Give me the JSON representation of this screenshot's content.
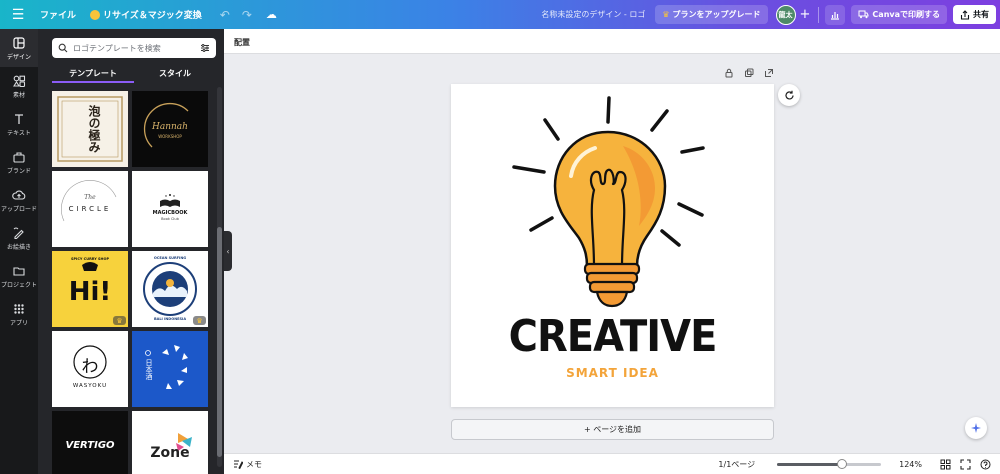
{
  "topbar": {
    "file_label": "ファイル",
    "magic_label": "リサイズ＆マジック変換",
    "doc_title": "名称未設定のデザイン - ロゴ",
    "upgrade_label": "プランをアップグレード",
    "avatar_initials": "龍太",
    "print_label": "Canvaで印刷する",
    "share_label": "共有"
  },
  "rail": [
    {
      "label": "デザイン",
      "icon": "design-icon"
    },
    {
      "label": "素材",
      "icon": "elements-icon"
    },
    {
      "label": "テキスト",
      "icon": "text-icon"
    },
    {
      "label": "ブランド",
      "icon": "brand-icon"
    },
    {
      "label": "アップロード",
      "icon": "upload-icon"
    },
    {
      "label": "お絵描き",
      "icon": "draw-icon"
    },
    {
      "label": "プロジェクト",
      "icon": "projects-icon"
    },
    {
      "label": "アプリ",
      "icon": "apps-icon"
    }
  ],
  "panel": {
    "search_placeholder": "ロゴテンプレートを検索",
    "tabs": [
      "テンプレート",
      "スタイル"
    ],
    "templates": [
      {
        "text": "泡の極み",
        "style": "awa"
      },
      {
        "text": "Hannah",
        "sub": "WORKSHOP",
        "style": "hannah"
      },
      {
        "text": "CIRCLE",
        "sub": "The",
        "style": "circle"
      },
      {
        "text": "MAGICBOOK",
        "sub": "Book Club",
        "style": "magicbook"
      },
      {
        "text": "Hi!",
        "sub": "SPICY CURRY SHOP",
        "style": "hi",
        "premium": true
      },
      {
        "text": "OCEAN SURFING",
        "sub": "BALI INDONESIA",
        "style": "ocean",
        "premium": true
      },
      {
        "text": "WASYOKU",
        "glyph": "わ",
        "style": "wasyoku"
      },
      {
        "text": "日本酒",
        "style": "sake"
      },
      {
        "text": "VERTIGO",
        "style": "vertigo"
      },
      {
        "text": "Zone",
        "style": "zone"
      }
    ]
  },
  "workspace": {
    "sub_label": "配置",
    "logo_title": "CREATIVE",
    "logo_subtitle": "SMART IDEA",
    "add_page_label": "+ ページを追加"
  },
  "bottombar": {
    "notes_label": "メモ",
    "page_count": "1/1ページ",
    "zoom_label": "124%",
    "zoom_fraction": 0.62
  },
  "colors": {
    "bulb_yellow": "#f6b33d",
    "bulb_orange": "#f39a34",
    "subtitle_orange": "#f3a43a",
    "accent_purple": "#8b5cf6"
  }
}
